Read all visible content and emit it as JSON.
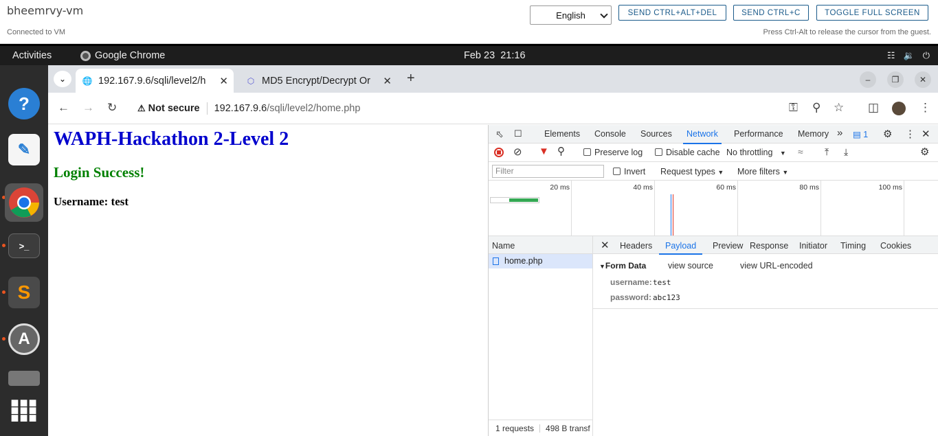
{
  "vm": {
    "name": "bheemrvy-vm",
    "status": "Connected to VM",
    "language": "English",
    "btn_ctrl_alt_del": "SEND CTRL+ALT+DEL",
    "btn_ctrl_c": "SEND CTRL+C",
    "btn_fullscreen": "TOGGLE FULL SCREEN",
    "hint": "Press Ctrl-Alt to release the cursor from the guest."
  },
  "topbar": {
    "activities": "Activities",
    "app": "Google Chrome",
    "date": "Feb 23",
    "time": "21:16"
  },
  "dock": {
    "items": [
      "help-icon",
      "text-editor-icon",
      "chrome-icon",
      "terminal-icon",
      "sublime-icon",
      "software-updater-icon",
      "drive-icon",
      "app-grid-icon"
    ]
  },
  "browser": {
    "tabs": [
      {
        "title": "192.167.9.6/sqli/level2/h"
      },
      {
        "title": "MD5 Encrypt/Decrypt Or"
      }
    ],
    "not_secure": "Not secure",
    "url_host": "192.167.9.6",
    "url_path": "/sqli/level2/home.php"
  },
  "page": {
    "title": "WAPH-Hackathon 2-Level 2",
    "status": "Login Success!",
    "username_line": "Username: test"
  },
  "devtools": {
    "tabs": [
      "Elements",
      "Console",
      "Sources",
      "Network",
      "Performance",
      "Memory"
    ],
    "more": "»",
    "issues_count": "1",
    "preserve_log": "Preserve log",
    "disable_cache": "Disable cache",
    "throttling": "No throttling",
    "filter_placeholder": "Filter",
    "invert": "Invert",
    "request_types": "Request types",
    "more_filters": "More filters",
    "timeline_ticks": [
      "20 ms",
      "40 ms",
      "60 ms",
      "80 ms",
      "100 ms"
    ],
    "name_header": "Name",
    "request_name": "home.php",
    "footer_requests": "1 requests",
    "footer_transfer": "498 B transf",
    "detail_tabs": [
      "Headers",
      "Payload",
      "Preview",
      "Response",
      "Initiator",
      "Timing",
      "Cookies"
    ],
    "form_data_label": "Form Data",
    "view_source": "view source",
    "view_url_encoded": "view URL-encoded",
    "fields": [
      {
        "key": "username:",
        "value": "test"
      },
      {
        "key": "password:",
        "value": "abc123"
      }
    ]
  }
}
